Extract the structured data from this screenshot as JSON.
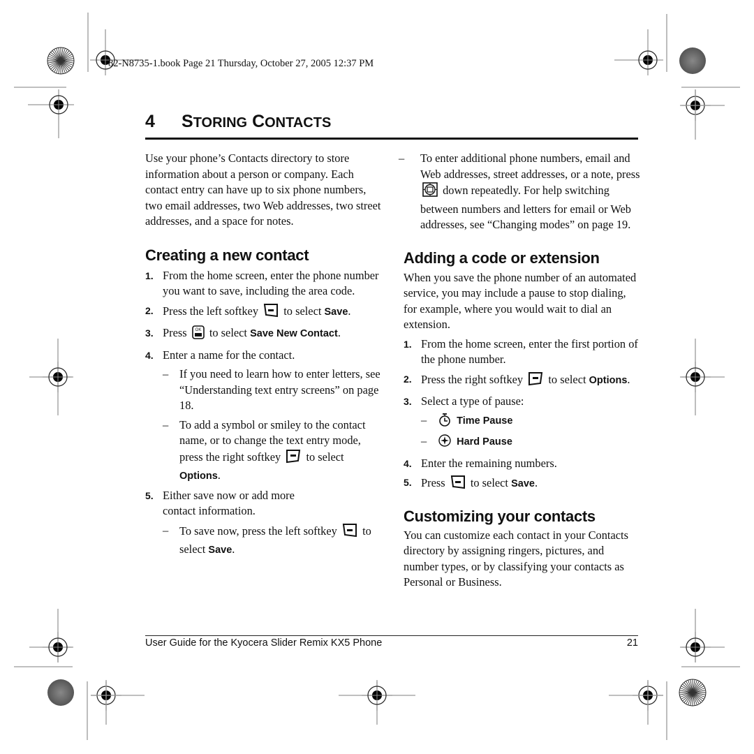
{
  "slug": "82-N8735-1.book  Page 21  Thursday, October 27, 2005  12:37 PM",
  "chapter": {
    "number": "4",
    "title_first_initial": "S",
    "title_first_rest": "TORING",
    "title_second_initial": "C",
    "title_second_rest": "ONTACTS"
  },
  "intro": "Use your phone’s Contacts directory to store information about a person or company. Each contact entry can have up to six phone numbers, two email addresses, two Web addresses, two street addresses, and a space for notes.",
  "creating": {
    "heading": "Creating a new contact",
    "steps": [
      {
        "num": "1.",
        "text": "From the home screen, enter the phone number you want to save, including the area code."
      },
      {
        "num": "2.",
        "before": "Press the left softkey",
        "after": "to select",
        "ui": "Save",
        "end": "."
      },
      {
        "num": "3.",
        "before": "Press",
        "after": "to select",
        "ui": "Save New Contact",
        "end": "."
      },
      {
        "num": "4.",
        "text": "Enter a name for the contact."
      },
      {
        "num": "5.",
        "text": "Either save now or add more contact information."
      }
    ],
    "step4_subs": [
      {
        "dash": "–",
        "text": "If you need to learn how to enter letters, see “Understanding text entry screens” on page 18."
      },
      {
        "dash": "–",
        "before": "To add a symbol or smiley to the contact name, or to change the text entry mode, press the right softkey",
        "after": "to select",
        "ui": "Options",
        "end": "."
      }
    ],
    "step5_subs": [
      {
        "dash": "–",
        "before": "To save now, press the left softkey",
        "after": "to select",
        "ui": "Save",
        "end": "."
      },
      {
        "dash": "–",
        "before": "To enter additional phone numbers, email and Web addresses, street addresses, or a note, press",
        "after": "down repeatedly. For help switching between numbers and letters for email or Web addresses, see “Changing modes” on page 19."
      }
    ]
  },
  "adding": {
    "heading": "Adding a code or extension",
    "intro": "When you save the phone number of an automated service, you may include a pause to stop dialing, for example, where you would wait to dial an extension.",
    "steps": [
      {
        "num": "1.",
        "text": "From the home screen, enter the first portion of the phone number."
      },
      {
        "num": "2.",
        "before": "Press the right softkey",
        "after": "to select",
        "ui": "Options",
        "end": "."
      },
      {
        "num": "3.",
        "text": "Select a type of pause:"
      },
      {
        "num": "4.",
        "text": "Enter the remaining numbers."
      },
      {
        "num": "5.",
        "before": "Press",
        "after": "to select",
        "ui": "Save",
        "end": "."
      }
    ],
    "pause_options": [
      {
        "dash": "–",
        "icon": "stopwatch-icon",
        "label": "Time Pause"
      },
      {
        "dash": "–",
        "icon": "hard-pause-icon",
        "label": "Hard Pause"
      }
    ]
  },
  "customizing": {
    "heading": "Customizing your contacts",
    "text": "You can customize each contact in your Contacts directory by assigning ringers, pictures, and number types, or by classifying your contacts as Personal or Business."
  },
  "footer": {
    "title": "User Guide for the Kyocera Slider Remix KX5 Phone",
    "page": "21"
  }
}
